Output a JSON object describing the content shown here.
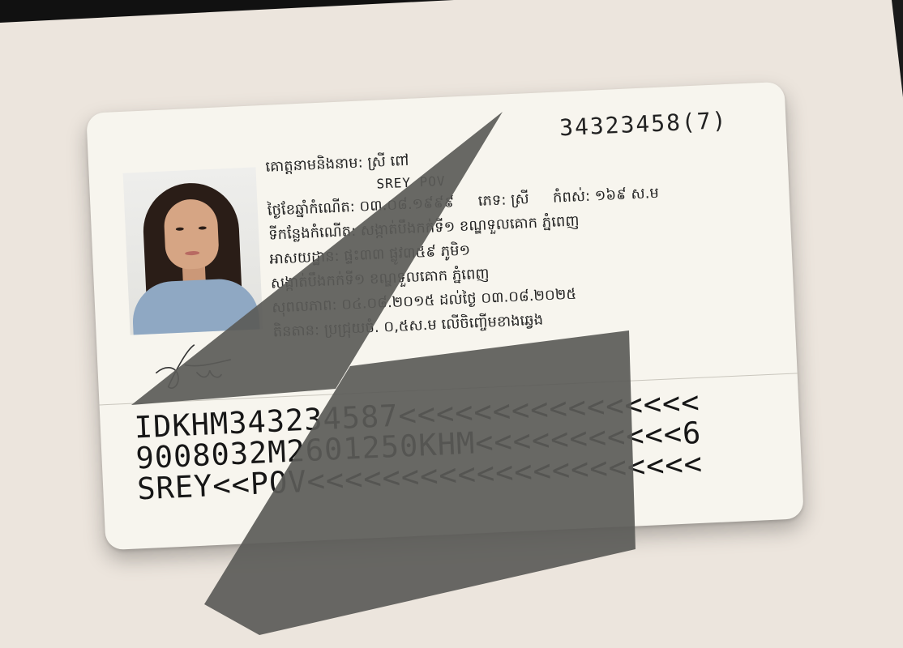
{
  "card": {
    "document_number": "34323458(7)",
    "name_line": "គោត្តនាមនិងនាម: ស្រី ពៅ",
    "name_latin": "SREY POV",
    "dob_label": "ថ្ងៃខែឆ្នាំកំណើត:",
    "dob_value": "០៣.០៨.១៩៩៩",
    "sex_label": "ភេទ:",
    "sex_value": "ស្រី",
    "height_label": "កំពស់:",
    "height_value": "១៦៩ ស.ម",
    "pob_line": "ទីកន្លែងកំណើត: សង្កាត់បឹងកក់ទី១ ខណ្ឌទួលគោក ភ្នំពេញ",
    "address_line1": "អាសយដ្ឋាន: ផ្ទះ៣៣ ផ្លូវ៣៥៩ ភូមិ១",
    "address_line2": "សង្កាត់បឹងកក់ទី១ ខណ្ឌទួលគោក ភ្នំពេញ",
    "validity_line": "សុពលភាព: ០៤.០៨.២០១៥ ដល់ថ្ងៃ ០៣.០៨.២០២៥",
    "marks_line": "តិនតាន: ប្រជ្រុយចំ. ០,៥ស.ម លើចិញ្ចើមខាងឆ្វេង",
    "mrz": [
      "IDKHM343234587<<<<<<<<<<<<<<<<",
      "9008032M2601250KHM<<<<<<<<<<<6",
      "SREY<<POV<<<<<<<<<<<<<<<<<<<<<"
    ]
  },
  "colors": {
    "background": "#ece5dd",
    "card": "#f7f5ee",
    "overlay": "#5b5b58"
  }
}
